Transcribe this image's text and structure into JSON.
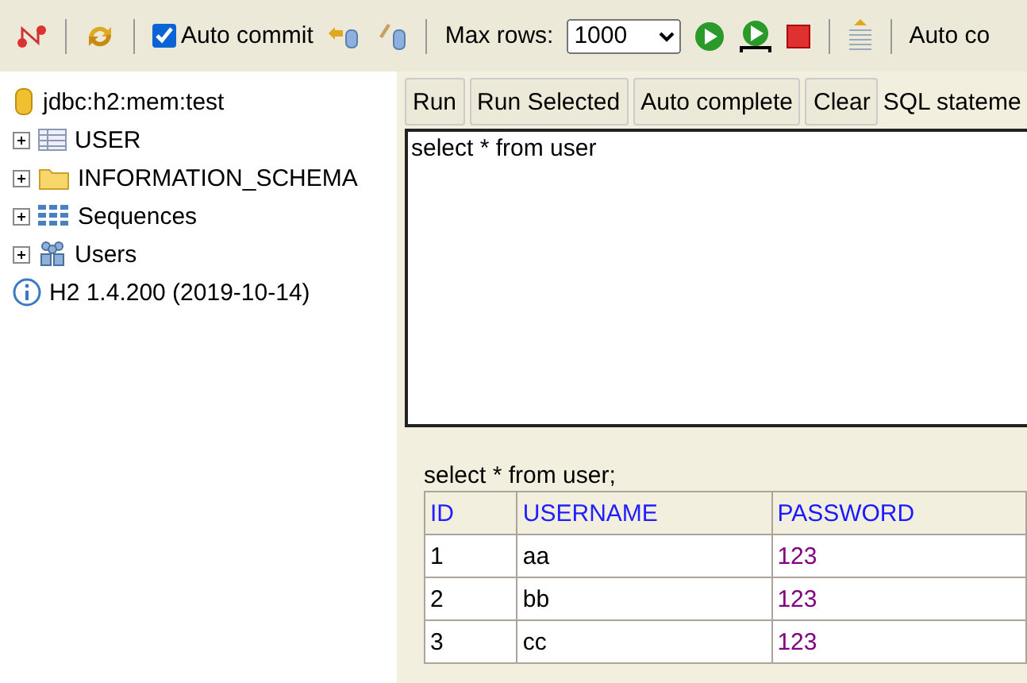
{
  "toolbar": {
    "auto_commit": {
      "label": "Auto commit",
      "checked": true
    },
    "max_rows": {
      "label": "Max rows:",
      "value": "1000"
    },
    "auto_complete": {
      "label": "Auto co"
    }
  },
  "tree": {
    "connection": "jdbc:h2:mem:test",
    "nodes": [
      {
        "kind": "table",
        "label": "USER",
        "expanded": false
      },
      {
        "kind": "folder",
        "label": "INFORMATION_SCHEMA",
        "expanded": false
      },
      {
        "kind": "sequences",
        "label": "Sequences",
        "expanded": false
      },
      {
        "kind": "users",
        "label": "Users",
        "expanded": false
      }
    ],
    "version": "H2 1.4.200 (2019-10-14)"
  },
  "query_buttons": [
    "Run",
    "Run Selected",
    "Auto complete",
    "Clear"
  ],
  "sql_label": "SQL stateme",
  "editor": {
    "value": "select * from user"
  },
  "result": {
    "statement": "select * from user;",
    "columns": [
      "ID",
      "USERNAME",
      "PASSWORD"
    ],
    "rows": [
      [
        "1",
        "aa",
        "123"
      ],
      [
        "2",
        "bb",
        "123"
      ],
      [
        "3",
        "cc",
        "123"
      ]
    ]
  }
}
